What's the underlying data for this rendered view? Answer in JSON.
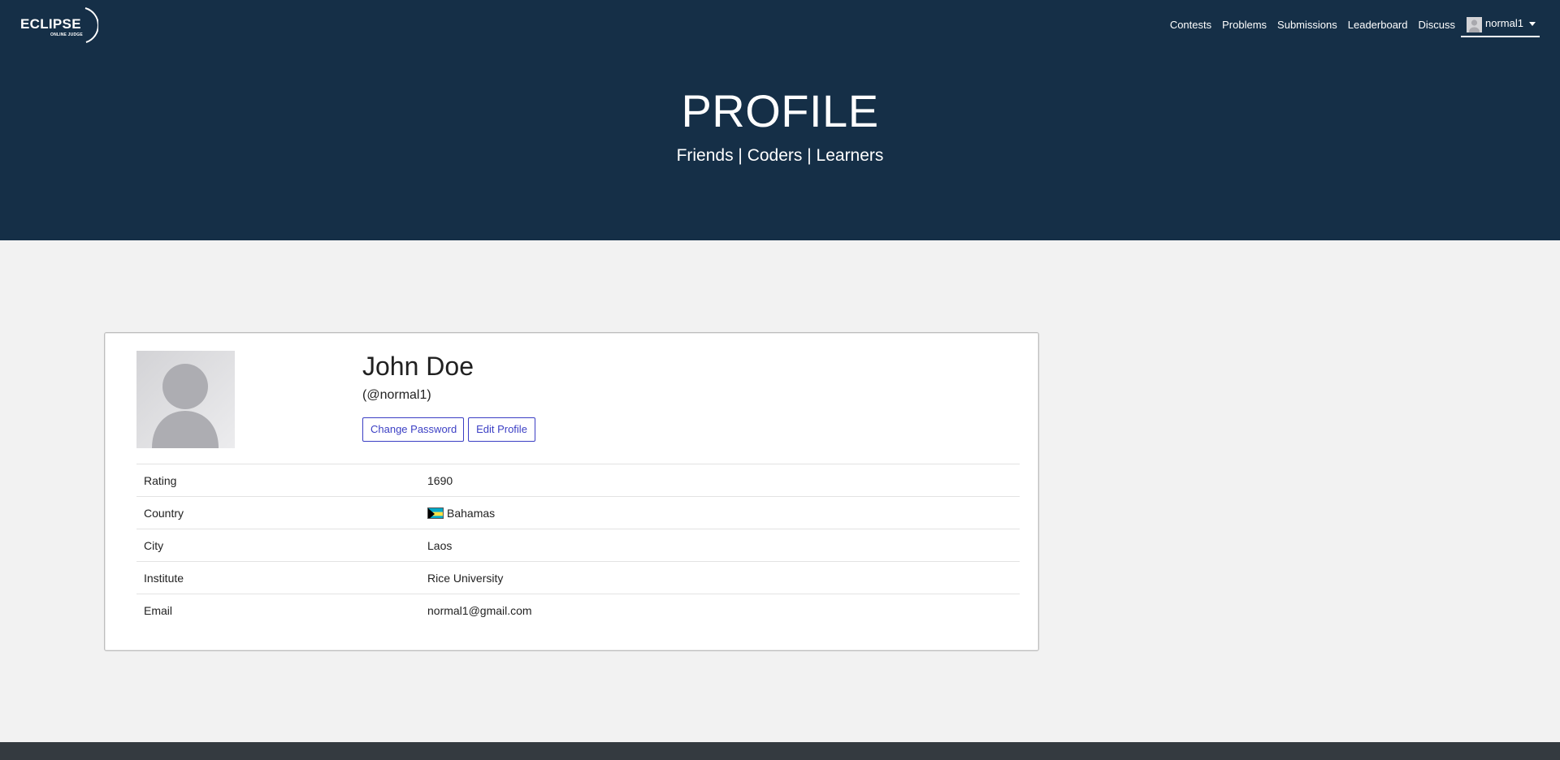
{
  "brand": {
    "logo_text": "ECLIPSE",
    "logo_subtext": "ONLINE JUDGE"
  },
  "nav": {
    "items": [
      {
        "label": "Contests"
      },
      {
        "label": "Problems"
      },
      {
        "label": "Submissions"
      },
      {
        "label": "Leaderboard"
      },
      {
        "label": "Discuss"
      }
    ],
    "user": {
      "name": "normal1"
    }
  },
  "hero": {
    "title": "PROFILE",
    "subtitle": "Friends | Coders | Learners"
  },
  "profile": {
    "full_name": "John Doe",
    "handle": "(@normal1)",
    "change_password_label": "Change Password",
    "edit_profile_label": "Edit Profile",
    "fields": [
      {
        "label": "Rating",
        "value": "1690"
      },
      {
        "label": "Country",
        "value": "Bahamas",
        "flag": "bahamas-flag-icon"
      },
      {
        "label": "City",
        "value": "Laos"
      },
      {
        "label": "Institute",
        "value": "Rice University"
      },
      {
        "label": "Email",
        "value": "normal1@gmail.com"
      }
    ]
  },
  "colors": {
    "header_bg": "#152f47",
    "page_bg": "#f2f2f2",
    "button_accent": "#3b3fc4",
    "footer_bg": "#343a40"
  }
}
